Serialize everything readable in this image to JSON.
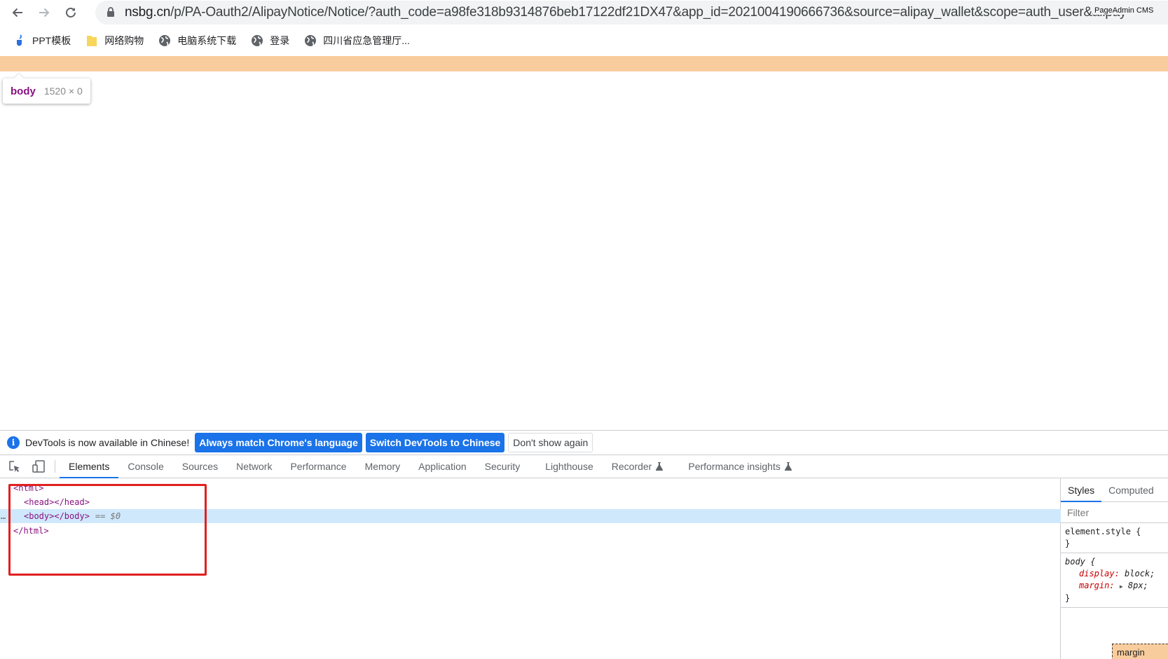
{
  "browser": {
    "url_host": "nsbg.cn",
    "url_path": "/p/PA-Oauth2/AlipayNotice/Notice/?auth_code=a98fe318b9314876beb17122df21DX47&app_id=2021004190666736&source=alipay_wallet&scope=auth_user&alipay",
    "extension_text": "PageAdmin CMS"
  },
  "bookmarks": [
    {
      "label": "PPT模板",
      "icon": "ppt-template-icon"
    },
    {
      "label": "网络购物",
      "icon": "folder-icon"
    },
    {
      "label": "电脑系统下载",
      "icon": "globe-icon"
    },
    {
      "label": "登录",
      "icon": "globe-icon"
    },
    {
      "label": "四川省应急管理厅...",
      "icon": "globe-icon"
    }
  ],
  "inspect_tooltip": {
    "tag": "body",
    "size": "1520 × 0"
  },
  "devtools": {
    "infobar": {
      "message": "DevTools is now available in Chinese!",
      "btn_match": "Always match Chrome's language",
      "btn_switch": "Switch DevTools to Chinese",
      "btn_dismiss": "Don't show again"
    },
    "tabs": [
      "Elements",
      "Console",
      "Sources",
      "Network",
      "Performance",
      "Memory",
      "Application",
      "Security",
      "Lighthouse",
      "Recorder",
      "Performance insights"
    ],
    "active_tab": "Elements",
    "dom": {
      "line1": "<html>",
      "line2": "<head></head>",
      "line3": "<body></body>",
      "line3_suffix": "== $0",
      "line4": "</html>",
      "dots": "…"
    },
    "styles": {
      "tab_styles": "Styles",
      "tab_computed": "Computed",
      "filter_placeholder": "Filter",
      "rule1_selector": "element.style {",
      "rule1_close": "}",
      "rule2_selector": "body {",
      "rule2_prop1": "display",
      "rule2_val1": "block;",
      "rule2_prop2": "margin",
      "rule2_val2": "8px;",
      "rule2_close": "}",
      "box_model_label": "margin"
    }
  },
  "colors": {
    "accent": "#1a73e8",
    "margin_highlight": "#f9cc9d",
    "annotation_red": "#e02020",
    "tag_purple": "#881280"
  }
}
